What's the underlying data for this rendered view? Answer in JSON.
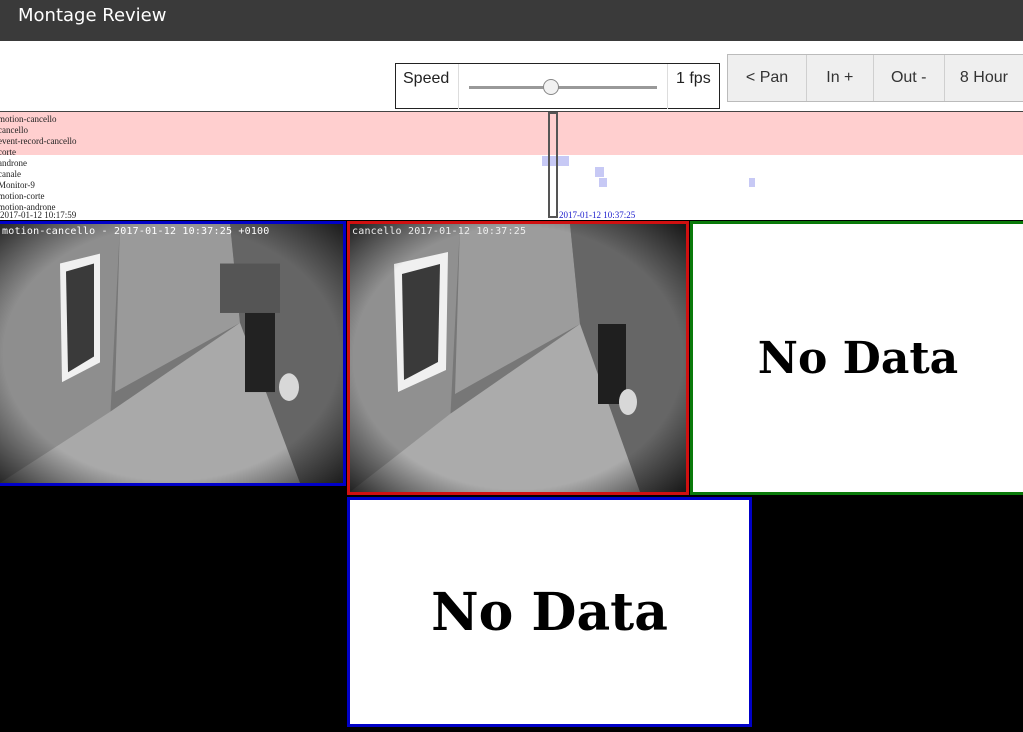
{
  "app": {
    "title": "Montage Review"
  },
  "speed": {
    "label": "Speed",
    "value_label": "1 fps",
    "slider_fraction": 0.4
  },
  "toolbar": {
    "buttons": [
      "< Pan",
      "In +",
      "Out -",
      "8 Hour"
    ]
  },
  "timeline": {
    "monitors": [
      "motion-cancello",
      "cancello",
      "event-record-cancello",
      "corte",
      "androne",
      "canale",
      "Monitor-9",
      "motion-corte",
      "motion-androne"
    ],
    "start_time": "2017-01-12 10:17:59",
    "current_time": "2017-01-12 10:37:25",
    "highlight_color": "#ffcfcf",
    "event_color": "#c7c9f5"
  },
  "monitors": [
    {
      "name": "motion-cancello",
      "overlay": "motion-cancello - 2017-01-12 10:37:25 +0100",
      "border": "#0000c8",
      "state": "video"
    },
    {
      "name": "cancello",
      "overlay": "cancello 2017-01-12 10:37:25",
      "border": "#d01010",
      "state": "video"
    },
    {
      "name": "corte",
      "text": "No Data",
      "border": "#0a7a0a",
      "state": "nodata"
    },
    {
      "name": "androne",
      "text": "No Data",
      "border": "#0000c8",
      "state": "nodata"
    }
  ]
}
